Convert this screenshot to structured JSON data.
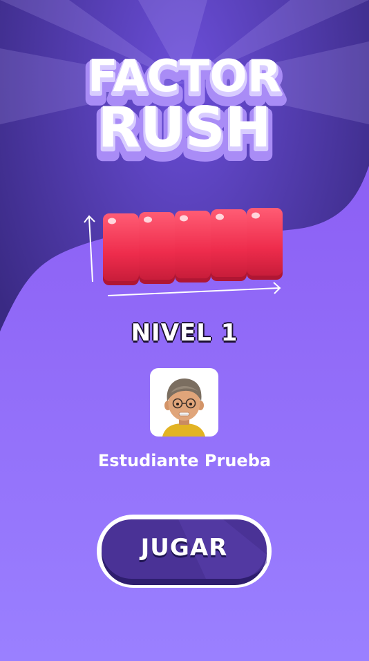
{
  "title": {
    "line1": "FACTOR",
    "line2": "RUSH"
  },
  "level_label": "NIVEL 1",
  "user": {
    "name": "Estudiante Prueba",
    "avatar_icon": "student-avatar"
  },
  "play_button_label": "JUGAR",
  "colors": {
    "background_dark": "#3b2a86",
    "background_light": "#8c66f5",
    "block_red": "#f0304e",
    "button_fill": "#4a3296"
  }
}
